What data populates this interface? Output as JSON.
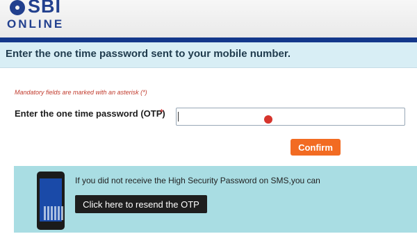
{
  "header": {
    "logo_main": "SBI",
    "logo_sub": "ONLINE"
  },
  "page": {
    "title": "Enter the one time password sent to your mobile number."
  },
  "form": {
    "mandatory_note": "Mandatory fields are marked with an asterisk (*)",
    "otp_label": "Enter the one time password (OTP)",
    "required_marker": "*",
    "otp_value": "",
    "confirm_label": "Confirm"
  },
  "resend": {
    "message": "If you did not receive the High Security Password on SMS,you can",
    "button_label": "Click here to resend the OTP"
  },
  "colors": {
    "brand": "#22408e",
    "confirm": "#f26b22",
    "panel": "#a9dde3"
  }
}
